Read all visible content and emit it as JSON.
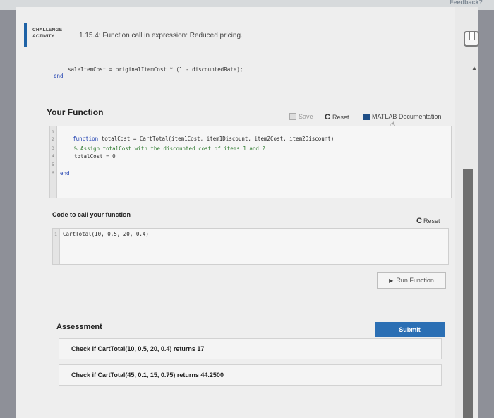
{
  "header": {
    "feedback_label": "Feedback?",
    "challenge_label_line1": "CHALLENGE",
    "challenge_label_line2": "ACTIVITY",
    "title": "1.15.4: Function call in expression: Reduced pricing."
  },
  "given_code": {
    "line": "saleItemCost = originalItemCost * (1 - discountedRate);",
    "end": "end"
  },
  "your_function": {
    "title": "Your Function",
    "save_label": "Save",
    "reset_label": "Reset",
    "docs_label": "MATLAB Documentation",
    "lines": [
      {
        "num": "1",
        "text": "function totalCost = CartTotal(item1Cost, item1Discount, item2Cost, item2Discount)"
      },
      {
        "num": "2",
        "text": ""
      },
      {
        "num": "3",
        "text": "% Assign totalCost with the discounted cost of items 1 and 2"
      },
      {
        "num": "4",
        "text": "totalCost = 0"
      },
      {
        "num": "5",
        "text": ""
      },
      {
        "num": "6",
        "text": "end"
      }
    ]
  },
  "call_code": {
    "title": "Code to call your function",
    "reset_label": "Reset",
    "line_num": "1",
    "line": "CartTotal(10, 0.5, 20, 0.4)",
    "run_label": "Run Function"
  },
  "assessment": {
    "title": "Assessment",
    "submit_label": "Submit",
    "checks": [
      {
        "prefix": "Check if ",
        "code": "CartTotal(10, 0.5, 20, 0.4)",
        "suffix": " returns 17"
      },
      {
        "prefix": "Check if ",
        "code": "CartTotal(45, 0.1, 15, 0.75)",
        "suffix": " returns 44.2500"
      }
    ]
  }
}
